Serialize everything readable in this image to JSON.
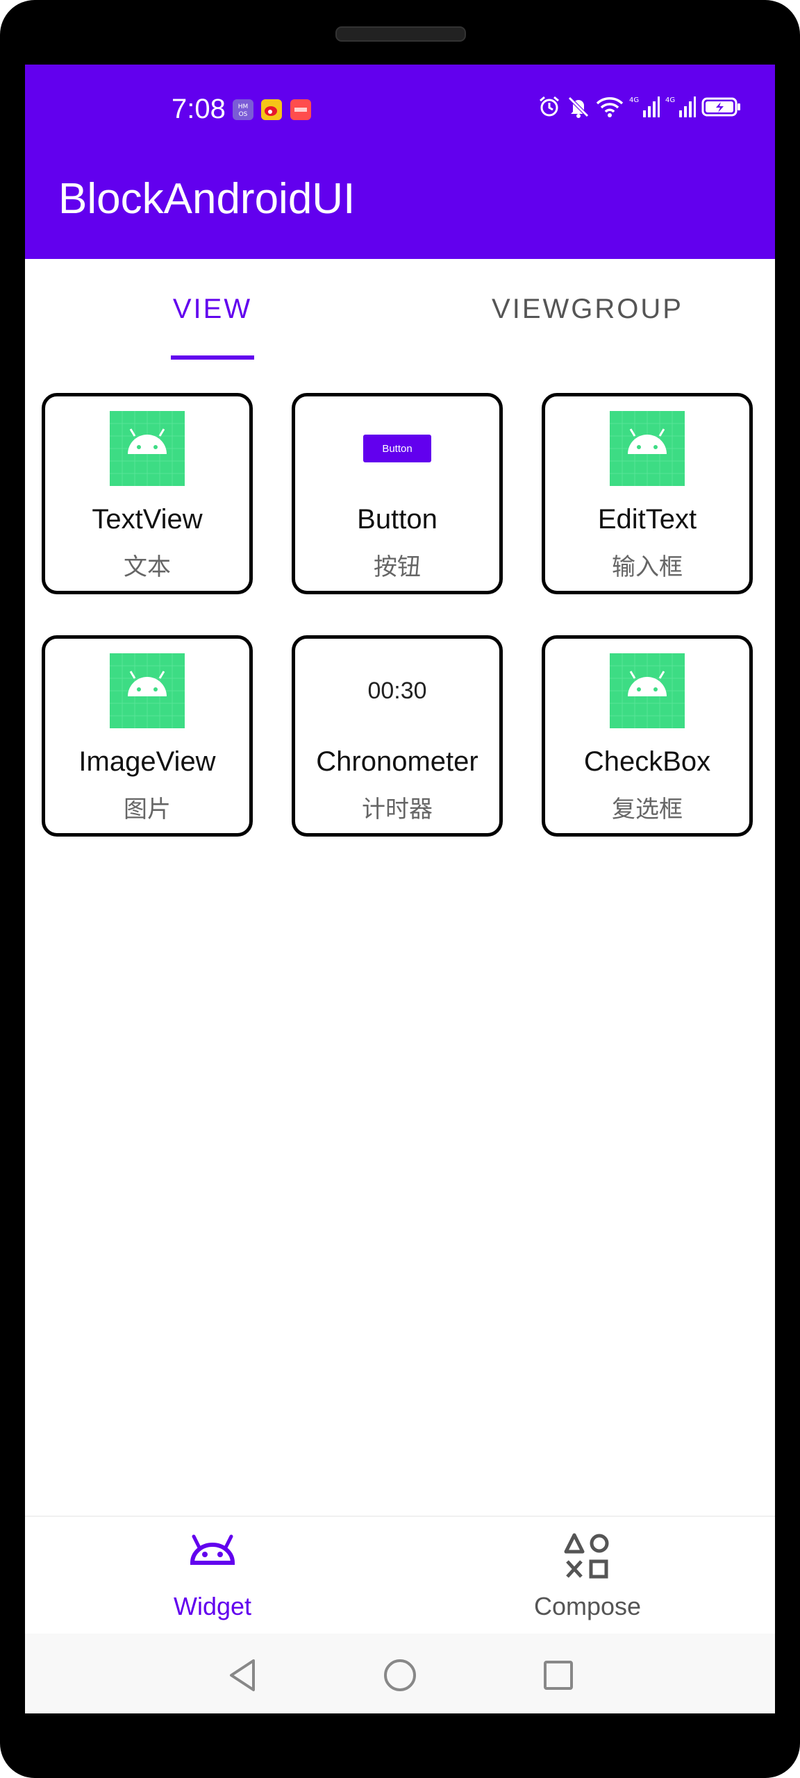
{
  "status_bar": {
    "time": "7:08",
    "left_icons": [
      "hmos-icon",
      "weibo-icon",
      "app-notification-icon"
    ],
    "right_icons": [
      "alarm-icon",
      "mute-icon",
      "wifi-icon",
      "signal-4g-icon",
      "signal-4g-icon",
      "battery-charging-icon"
    ]
  },
  "app_bar": {
    "title": "BlockAndroidUI",
    "color": "#6200ee"
  },
  "tabs": [
    {
      "label": "VIEW",
      "selected": true
    },
    {
      "label": "VIEWGROUP",
      "selected": false
    }
  ],
  "widgets": [
    {
      "name": "TextView",
      "subtitle": "文本",
      "icon": "android-image-icon"
    },
    {
      "name": "Button",
      "subtitle": "按钮",
      "icon": "button-preview",
      "preview_label": "Button"
    },
    {
      "name": "EditText",
      "subtitle": "输入框",
      "icon": "android-image-icon"
    },
    {
      "name": "ImageView",
      "subtitle": "图片",
      "icon": "android-image-icon"
    },
    {
      "name": "Chronometer",
      "subtitle": "计时器",
      "icon": "chronometer-preview",
      "preview_label": "00:30"
    },
    {
      "name": "CheckBox",
      "subtitle": "复选框",
      "icon": "android-image-icon"
    }
  ],
  "bottom_nav": [
    {
      "label": "Widget",
      "icon": "android-icon",
      "selected": true
    },
    {
      "label": "Compose",
      "icon": "shapes-icon",
      "selected": false
    }
  ],
  "system_nav": [
    "back-icon",
    "home-icon",
    "recents-icon"
  ],
  "colors": {
    "accent": "#6200ee",
    "android_green": "#3ddc84"
  }
}
